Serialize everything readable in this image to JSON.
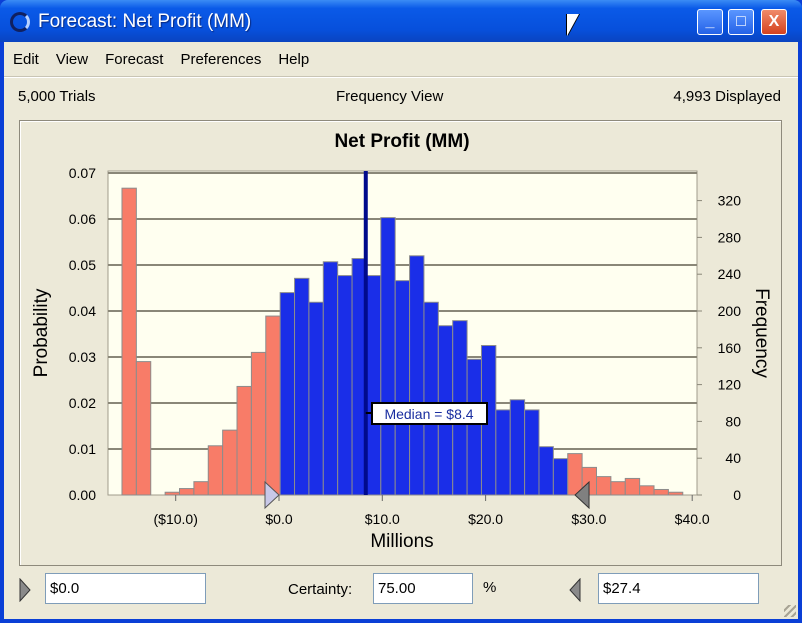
{
  "window": {
    "title": "Forecast: Net Profit (MM)",
    "minimize": "_",
    "maximize": "□",
    "close": "X"
  },
  "menu": [
    "Edit",
    "View",
    "Forecast",
    "Preferences",
    "Help"
  ],
  "info": {
    "trials": "5,000 Trials",
    "view": "Frequency View",
    "displayed": "4,993 Displayed"
  },
  "colors": {
    "tail": "#f87c68",
    "center": "#1a2ee8",
    "median": "#000a8c",
    "plot_bg": "#fffff0"
  },
  "chart_data": {
    "type": "bar",
    "title": "Net Profit (MM)",
    "xlabel": "Millions",
    "ylabel": "Probability",
    "ylabel_right": "Frequency",
    "xlim": [
      -15.2,
      40.4
    ],
    "ylim": [
      0,
      0.07
    ],
    "ylim_right": [
      0,
      350
    ],
    "x_ticks": [
      {
        "value": -10,
        "label": "($10.0)"
      },
      {
        "value": 0,
        "label": "$0.0"
      },
      {
        "value": 10,
        "label": "$10.0"
      },
      {
        "value": 20,
        "label": "$20.0"
      },
      {
        "value": 30,
        "label": "$30.0"
      },
      {
        "value": 40,
        "label": "$40.0"
      }
    ],
    "y_ticks": [
      "0.00",
      "0.01",
      "0.02",
      "0.03",
      "0.04",
      "0.05",
      "0.06",
      "0.07"
    ],
    "y_ticks_right": [
      "0",
      "40",
      "80",
      "120",
      "160",
      "200",
      "240",
      "280",
      "320"
    ],
    "grid": true,
    "bin_start": -15.2,
    "bin_width": 1.392,
    "values": [
      0.0667,
      0.029,
      0,
      0.0006,
      0.0014,
      0.0029,
      0.0107,
      0.0141,
      0.0236,
      0.031,
      0.0389,
      0.044,
      0.0471,
      0.0419,
      0.0507,
      0.0477,
      0.0514,
      0.0477,
      0.0603,
      0.0466,
      0.052,
      0.0419,
      0.0368,
      0.0379,
      0.0295,
      0.0325,
      0.0185,
      0.0207,
      0.0185,
      0.0105,
      0.0079,
      0.009,
      0.006,
      0.004,
      0.0029,
      0.0036,
      0.002,
      0.0012,
      0.0006
    ],
    "certainty_range": [
      0.0,
      27.4
    ],
    "median": 8.4,
    "median_label": "Median = $8.4"
  },
  "controls": {
    "lower": "$0.0",
    "certainty_label": "Certainty:",
    "certainty": "75.00",
    "percent": "%",
    "upper": "$27.4"
  }
}
